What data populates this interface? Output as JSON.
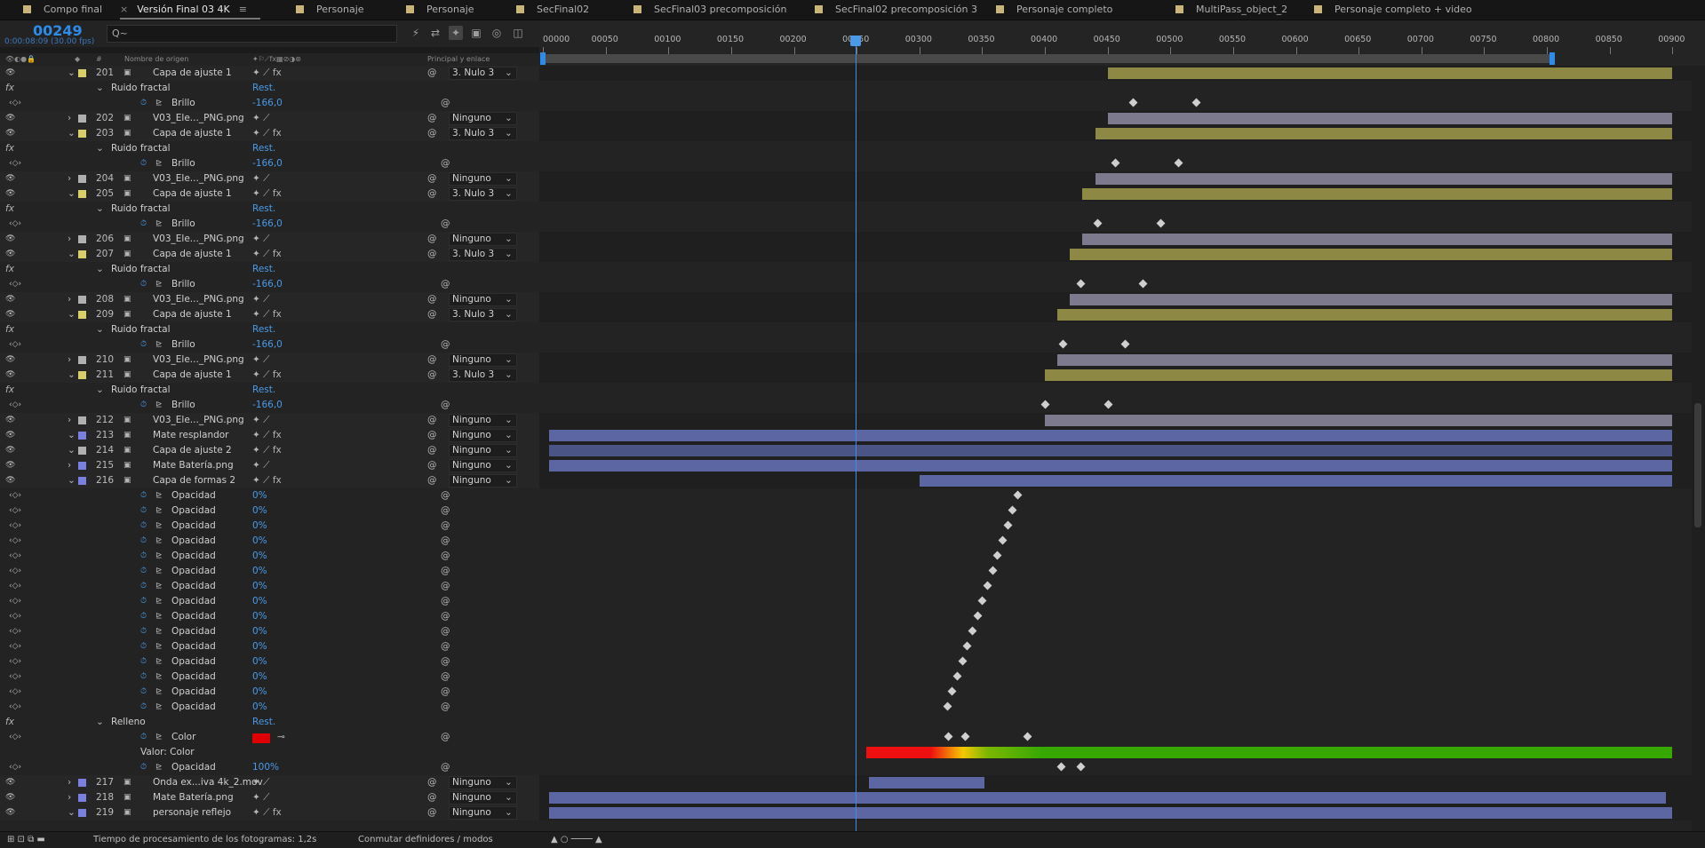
{
  "tabs": [
    "Compo final",
    "Versión Final 03 4K",
    "Personaje",
    "Personaje",
    "SecFinal02",
    "SecFinal03 precomposición",
    "SecFinal02 precomposición 3",
    "Personaje completo",
    "MultiPass_object_2",
    "Personaje completo + video"
  ],
  "tab_colors": [
    "#c9b57a",
    "#c9b57a",
    "#c9b57a",
    "#c9b57a",
    "#c9b57a",
    "#c9b57a",
    "#c9b57a",
    "#c9b57a",
    "#c9b57a",
    "#c9b57a"
  ],
  "active_tab": 1,
  "timecode": "00249",
  "fps_label": "0:00:08:09 (30.00 fps)",
  "search_placeholder": "Q~",
  "columns": {
    "source_name": "Nombre de origen",
    "hash": "#",
    "parent": "Principal y enlace"
  },
  "ruler_ticks": [
    "00000",
    "00050",
    "00100",
    "00150",
    "00200",
    "00250",
    "00300",
    "00350",
    "00400",
    "00450",
    "00500",
    "00550",
    "00600",
    "00650",
    "00700",
    "00750",
    "00800",
    "00850",
    "00900"
  ],
  "current_frame": 249,
  "layers": [
    {
      "type": "layer",
      "num": "201",
      "name": "Capa de ajuste 1",
      "color": "#d9cf6a",
      "fx": true,
      "parent": "3. Nulo 3",
      "bar": {
        "start": 450,
        "end": 900,
        "color": "#8e8845"
      }
    },
    {
      "type": "group",
      "name": "Ruido fractal",
      "value": "Rest."
    },
    {
      "type": "prop",
      "name": "Brillo",
      "value": "-166,0",
      "keys": [
        470,
        520
      ]
    },
    {
      "type": "layer",
      "num": "202",
      "name": "V03_Ele..._PNG.png",
      "color": "#b0b0b0",
      "parent": "Ninguno",
      "bar": {
        "start": 450,
        "end": 900,
        "color": "#7c7a8c"
      }
    },
    {
      "type": "layer",
      "num": "203",
      "name": "Capa de ajuste 1",
      "color": "#d9cf6a",
      "fx": true,
      "parent": "3. Nulo 3",
      "bar": {
        "start": 440,
        "end": 900,
        "color": "#8e8845"
      }
    },
    {
      "type": "group",
      "name": "Ruido fractal",
      "value": "Rest."
    },
    {
      "type": "prop",
      "name": "Brillo",
      "value": "-166,0",
      "keys": [
        456,
        506
      ]
    },
    {
      "type": "layer",
      "num": "204",
      "name": "V03_Ele..._PNG.png",
      "color": "#b0b0b0",
      "parent": "Ninguno",
      "bar": {
        "start": 440,
        "end": 900,
        "color": "#7c7a8c"
      }
    },
    {
      "type": "layer",
      "num": "205",
      "name": "Capa de ajuste 1",
      "color": "#d9cf6a",
      "fx": true,
      "parent": "3. Nulo 3",
      "bar": {
        "start": 430,
        "end": 900,
        "color": "#8e8845"
      }
    },
    {
      "type": "group",
      "name": "Ruido fractal",
      "value": "Rest."
    },
    {
      "type": "prop",
      "name": "Brillo",
      "value": "-166,0",
      "keys": [
        442,
        492
      ]
    },
    {
      "type": "layer",
      "num": "206",
      "name": "V03_Ele..._PNG.png",
      "color": "#b0b0b0",
      "parent": "Ninguno",
      "bar": {
        "start": 430,
        "end": 900,
        "color": "#7c7a8c"
      }
    },
    {
      "type": "layer",
      "num": "207",
      "name": "Capa de ajuste 1",
      "color": "#d9cf6a",
      "fx": true,
      "parent": "3. Nulo 3",
      "bar": {
        "start": 420,
        "end": 900,
        "color": "#8e8845"
      }
    },
    {
      "type": "group",
      "name": "Ruido fractal",
      "value": "Rest."
    },
    {
      "type": "prop",
      "name": "Brillo",
      "value": "-166,0",
      "keys": [
        428,
        478
      ]
    },
    {
      "type": "layer",
      "num": "208",
      "name": "V03_Ele..._PNG.png",
      "color": "#b0b0b0",
      "parent": "Ninguno",
      "bar": {
        "start": 420,
        "end": 900,
        "color": "#7c7a8c"
      }
    },
    {
      "type": "layer",
      "num": "209",
      "name": "Capa de ajuste 1",
      "color": "#d9cf6a",
      "fx": true,
      "parent": "3. Nulo 3",
      "bar": {
        "start": 410,
        "end": 900,
        "color": "#8e8845"
      }
    },
    {
      "type": "group",
      "name": "Ruido fractal",
      "value": "Rest."
    },
    {
      "type": "prop",
      "name": "Brillo",
      "value": "-166,0",
      "keys": [
        414,
        464
      ]
    },
    {
      "type": "layer",
      "num": "210",
      "name": "V03_Ele..._PNG.png",
      "color": "#b0b0b0",
      "parent": "Ninguno",
      "bar": {
        "start": 410,
        "end": 900,
        "color": "#7c7a8c"
      }
    },
    {
      "type": "layer",
      "num": "211",
      "name": "Capa de ajuste 1",
      "color": "#d9cf6a",
      "fx": true,
      "parent": "3. Nulo 3",
      "bar": {
        "start": 400,
        "end": 900,
        "color": "#8e8845"
      }
    },
    {
      "type": "group",
      "name": "Ruido fractal",
      "value": "Rest."
    },
    {
      "type": "prop",
      "name": "Brillo",
      "value": "-166,0",
      "keys": [
        400,
        450
      ]
    },
    {
      "type": "layer",
      "num": "212",
      "name": "V03_Ele..._PNG.png",
      "color": "#b0b0b0",
      "parent": "Ninguno",
      "bar": {
        "start": 400,
        "end": 900,
        "color": "#7c7a8c"
      }
    },
    {
      "type": "layer",
      "num": "213",
      "name": "Mate resplandor",
      "color": "#7b7fe0",
      "fx": true,
      "parent": "Ninguno",
      "bar": {
        "start": 5,
        "end": 900,
        "color": "#5b66a2"
      }
    },
    {
      "type": "layer",
      "num": "214",
      "name": "Capa de ajuste 2",
      "color": "#b0b0b0",
      "fx": true,
      "parent": "Ninguno",
      "bar": {
        "start": 5,
        "end": 900,
        "color": "#4b5585"
      }
    },
    {
      "type": "layer",
      "num": "215",
      "name": "Mate Batería.png",
      "color": "#7b7fe0",
      "parent": "Ninguno",
      "bar": {
        "start": 5,
        "end": 900,
        "color": "#5b66a2"
      }
    },
    {
      "type": "layer",
      "num": "216",
      "name": "Capa de formas 2",
      "color": "#7b7fe0",
      "fx": true,
      "parent": "Ninguno",
      "bar": {
        "start": 300,
        "end": 900,
        "color": "#5b66a2"
      }
    },
    {
      "type": "prop",
      "name": "Opacidad",
      "value": "0%",
      "keys": [
        378
      ]
    },
    {
      "type": "prop",
      "name": "Opacidad",
      "value": "0%",
      "keys": [
        374
      ]
    },
    {
      "type": "prop",
      "name": "Opacidad",
      "value": "0%",
      "keys": [
        370
      ]
    },
    {
      "type": "prop",
      "name": "Opacidad",
      "value": "0%",
      "keys": [
        366
      ]
    },
    {
      "type": "prop",
      "name": "Opacidad",
      "value": "0%",
      "keys": [
        362
      ]
    },
    {
      "type": "prop",
      "name": "Opacidad",
      "value": "0%",
      "keys": [
        358
      ]
    },
    {
      "type": "prop",
      "name": "Opacidad",
      "value": "0%",
      "keys": [
        354
      ]
    },
    {
      "type": "prop",
      "name": "Opacidad",
      "value": "0%",
      "keys": [
        350
      ]
    },
    {
      "type": "prop",
      "name": "Opacidad",
      "value": "0%",
      "keys": [
        346
      ]
    },
    {
      "type": "prop",
      "name": "Opacidad",
      "value": "0%",
      "keys": [
        342
      ]
    },
    {
      "type": "prop",
      "name": "Opacidad",
      "value": "0%",
      "keys": [
        338
      ]
    },
    {
      "type": "prop",
      "name": "Opacidad",
      "value": "0%",
      "keys": [
        334
      ]
    },
    {
      "type": "prop",
      "name": "Opacidad",
      "value": "0%",
      "keys": [
        330
      ]
    },
    {
      "type": "prop",
      "name": "Opacidad",
      "value": "0%",
      "keys": [
        326
      ]
    },
    {
      "type": "prop",
      "name": "Opacidad",
      "value": "0%",
      "keys": [
        322
      ]
    },
    {
      "type": "group",
      "name": "Relleno",
      "value": "Rest."
    },
    {
      "type": "prop",
      "name": "Color",
      "value": "",
      "keys": [
        323,
        336,
        386
      ],
      "swatch": true
    },
    {
      "type": "label",
      "name": "Valor: Color",
      "gradient": true
    },
    {
      "type": "prop",
      "name": "Opacidad",
      "value": "100%",
      "keys": [
        413,
        428
      ]
    },
    {
      "type": "layer",
      "num": "217",
      "name": "Onda ex...iva 4k_2.mov",
      "color": "#7b7fe0",
      "parent": "Ninguno",
      "bar": {
        "start": 260,
        "end": 352,
        "color": "#5b66a2"
      }
    },
    {
      "type": "layer",
      "num": "218",
      "name": "Mate Batería.png",
      "color": "#7b7fe0",
      "parent": "Ninguno",
      "bar": {
        "start": 5,
        "end": 895,
        "color": "#5b66a2"
      }
    },
    {
      "type": "layer",
      "num": "219",
      "name": "personaje reflejo",
      "color": "#7b7fe0",
      "fx": true,
      "parent": "Ninguno",
      "bar": {
        "start": 5,
        "end": 900,
        "color": "#5b66a2"
      }
    }
  ],
  "footer": {
    "render_time": "Tiempo de procesamiento de los fotogramas: 1,2s",
    "toggle": "Conmutar definidores / modos"
  }
}
